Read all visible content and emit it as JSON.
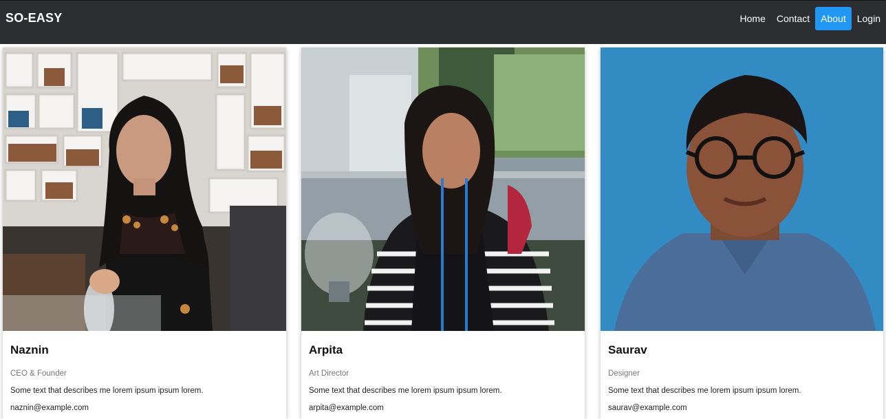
{
  "nav": {
    "brand": "SO-EASY",
    "links": [
      "Home",
      "Contact",
      "About",
      "Login"
    ],
    "active": "About"
  },
  "team": [
    {
      "name": "Naznin",
      "role": "CEO & Founder",
      "description": "Some text that describes me lorem ipsum ipsum lorem.",
      "email": "naznin@example.com"
    },
    {
      "name": "Arpita",
      "role": "Art Director",
      "description": "Some text that describes me lorem ipsum ipsum lorem.",
      "email": "arpita@example.com"
    },
    {
      "name": "Saurav",
      "role": "Designer",
      "description": "Some text that describes me lorem ipsum ipsum lorem.",
      "email": "saurav@example.com"
    }
  ],
  "colors": {
    "navbar_bg": "#2b2d30",
    "active_link": "#2196f3"
  }
}
